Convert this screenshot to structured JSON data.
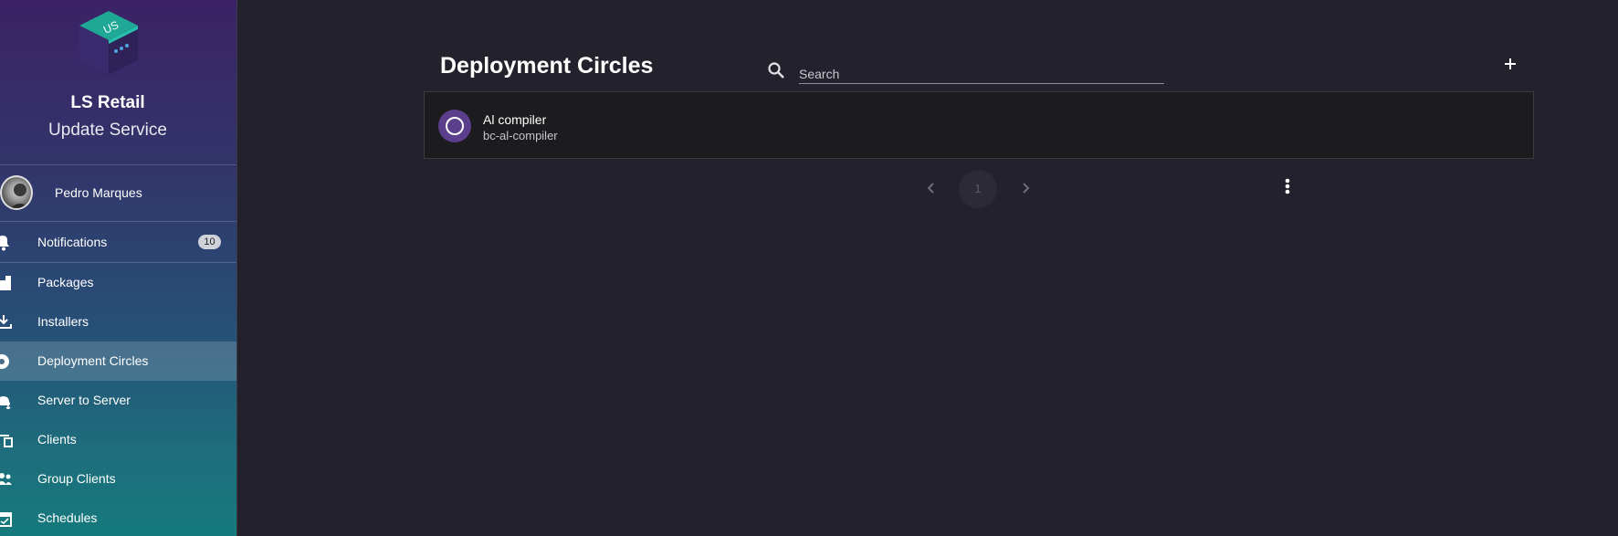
{
  "sidebar": {
    "brand": {
      "name": "LS Retail",
      "subtitle": "Update Service",
      "logo_text": "US"
    },
    "user": {
      "name": "Pedro Marques"
    },
    "items": [
      {
        "label": "Notifications",
        "icon": "bell-icon",
        "badge": "10"
      },
      {
        "label": "Packages",
        "icon": "package-icon"
      },
      {
        "label": "Installers",
        "icon": "download-icon"
      },
      {
        "label": "Deployment Circles",
        "icon": "circle-icon",
        "active": true
      },
      {
        "label": "Server to Server",
        "icon": "cloud-sync-icon"
      },
      {
        "label": "Clients",
        "icon": "devices-icon"
      },
      {
        "label": "Group Clients",
        "icon": "people-icon"
      },
      {
        "label": "Schedules",
        "icon": "calendar-check-icon"
      }
    ]
  },
  "main": {
    "title": "Deployment Circles",
    "search": {
      "placeholder": "Search",
      "value": ""
    },
    "list": [
      {
        "title": "Al compiler",
        "subtitle": "bc-al-compiler"
      }
    ],
    "pagination": {
      "current_page": "1"
    }
  },
  "colors": {
    "background": "#23222c",
    "sidebar_top": "#3b2266",
    "sidebar_bottom": "#167a7c",
    "item_avatar": "#5b3f8c"
  }
}
